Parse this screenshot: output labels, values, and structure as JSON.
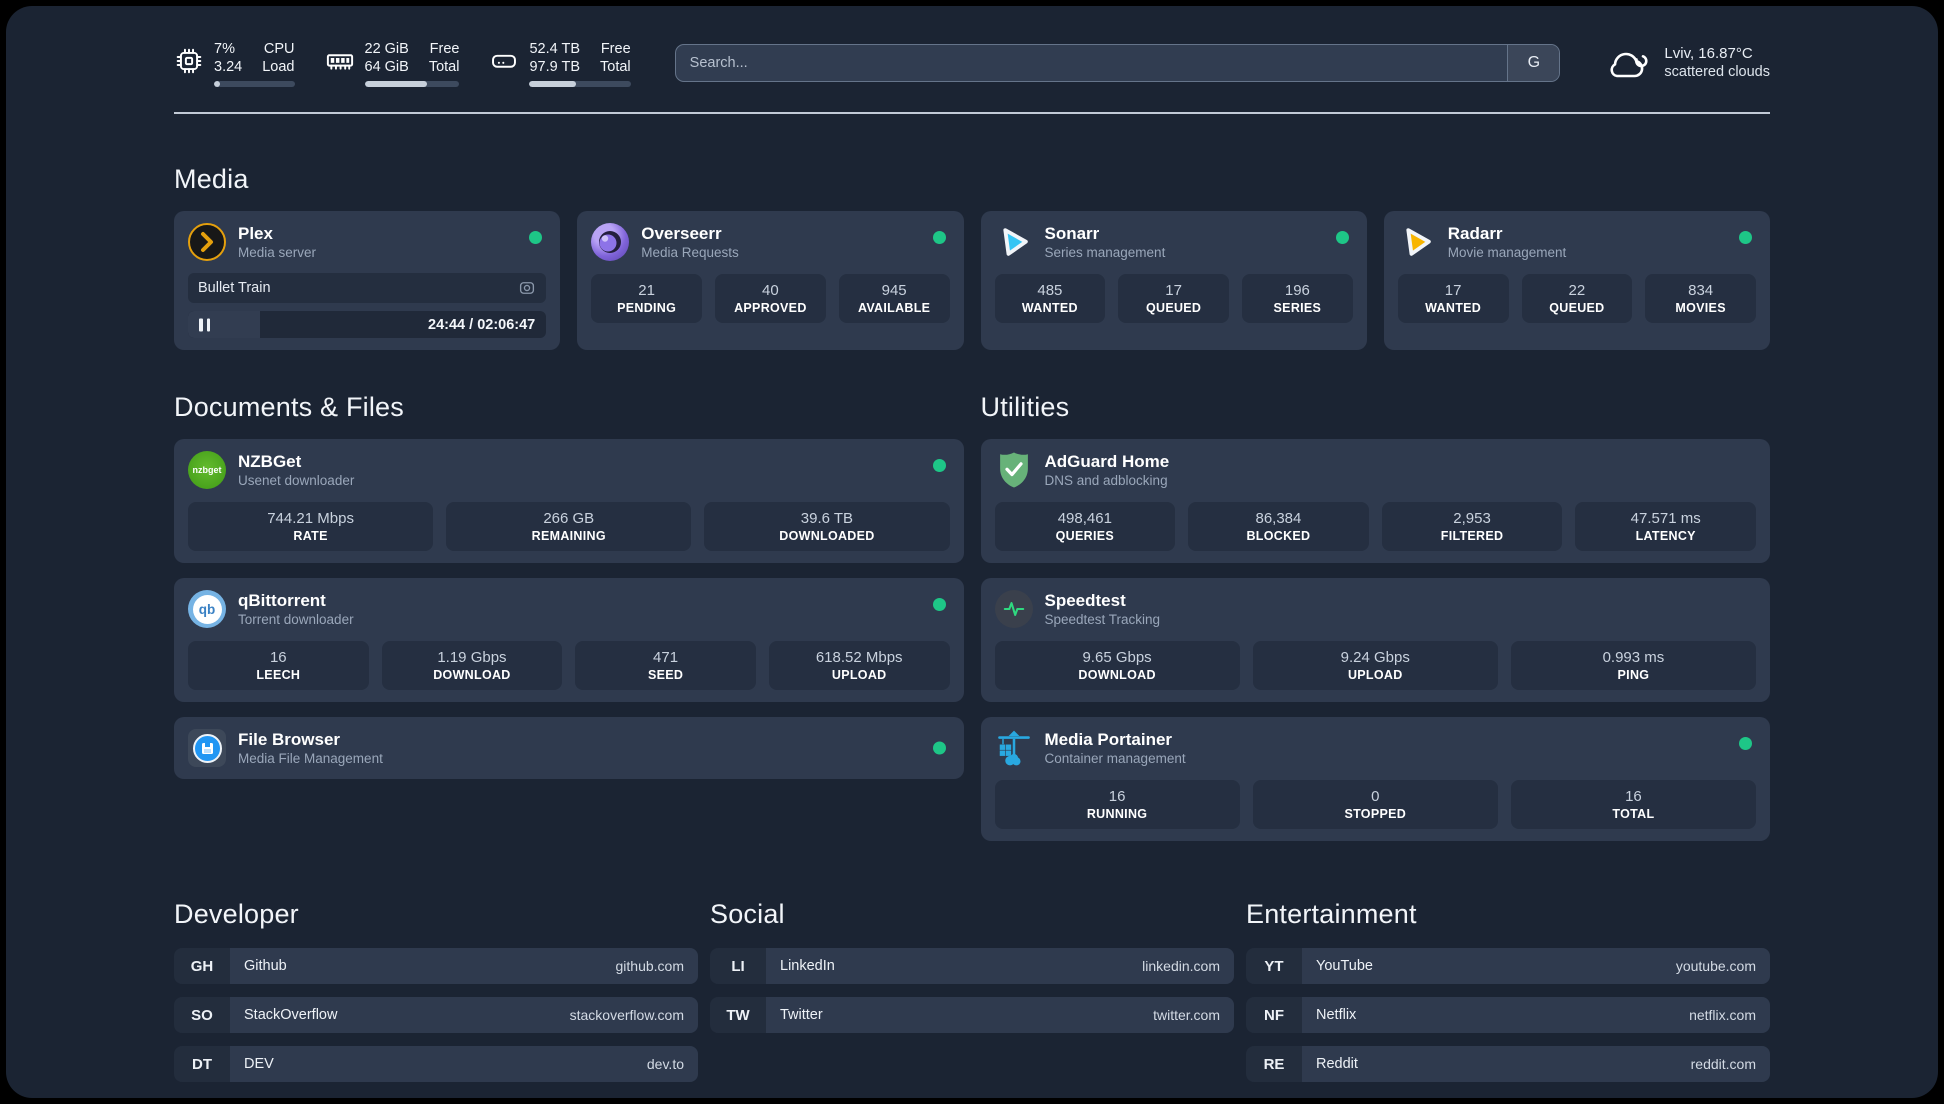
{
  "colors": {
    "accent_green": "#1ec687",
    "plex_amber": "#e5a00d",
    "sonarr_blue": "#35c5f4",
    "radarr_yellow": "#f8b500",
    "nzbget_green": "#4caf2f",
    "qbittorrent_blue": "#76b3e4",
    "adguard_green": "#67b279",
    "portainer_blue": "#29a8e0",
    "card_bg": "#2f3a4e",
    "page_bg": "#1b2433"
  },
  "header": {
    "stats": [
      {
        "icon": "cpu-icon",
        "value_top": "7%",
        "value_bottom": "3.24",
        "label_top": "CPU",
        "label_bottom": "Load",
        "progress_pct": 7
      },
      {
        "icon": "ram-icon",
        "value_top": "22 GiB",
        "value_bottom": "64 GiB",
        "label_top": "Free",
        "label_bottom": "Total",
        "progress_pct": 66
      },
      {
        "icon": "disk-icon",
        "value_top": "52.4 TB",
        "value_bottom": "97.9 TB",
        "label_top": "Free",
        "label_bottom": "Total",
        "progress_pct": 46
      }
    ],
    "search": {
      "placeholder": "Search...",
      "engine_label": "G"
    },
    "weather": {
      "location": "Lviv, 16.87°C",
      "condition": "scattered clouds"
    }
  },
  "sections": {
    "media": {
      "title": "Media",
      "plex": {
        "title": "Plex",
        "subtitle": "Media server",
        "online": true,
        "now_playing": "Bullet Train",
        "time": "24:44 / 02:06:47",
        "progress_pct": 20
      },
      "overseerr": {
        "title": "Overseerr",
        "subtitle": "Media Requests",
        "online": true,
        "stats": [
          {
            "value": "21",
            "label": "PENDING"
          },
          {
            "value": "40",
            "label": "APPROVED"
          },
          {
            "value": "945",
            "label": "AVAILABLE"
          }
        ]
      },
      "sonarr": {
        "title": "Sonarr",
        "subtitle": "Series management",
        "online": true,
        "stats": [
          {
            "value": "485",
            "label": "WANTED"
          },
          {
            "value": "17",
            "label": "QUEUED"
          },
          {
            "value": "196",
            "label": "SERIES"
          }
        ]
      },
      "radarr": {
        "title": "Radarr",
        "subtitle": "Movie management",
        "online": true,
        "stats": [
          {
            "value": "17",
            "label": "WANTED"
          },
          {
            "value": "22",
            "label": "QUEUED"
          },
          {
            "value": "834",
            "label": "MOVIES"
          }
        ]
      }
    },
    "documents": {
      "title": "Documents & Files",
      "nzbget": {
        "title": "NZBGet",
        "subtitle": "Usenet downloader",
        "online": true,
        "icon_text": "nzbget",
        "stats": [
          {
            "value": "744.21 Mbps",
            "label": "RATE"
          },
          {
            "value": "266 GB",
            "label": "REMAINING"
          },
          {
            "value": "39.6 TB",
            "label": "DOWNLOADED"
          }
        ]
      },
      "qbittorrent": {
        "title": "qBittorrent",
        "subtitle": "Torrent downloader",
        "online": true,
        "icon_text": "qb",
        "stats": [
          {
            "value": "16",
            "label": "LEECH"
          },
          {
            "value": "1.19 Gbps",
            "label": "DOWNLOAD"
          },
          {
            "value": "471",
            "label": "SEED"
          },
          {
            "value": "618.52 Mbps",
            "label": "UPLOAD"
          }
        ]
      },
      "filebrowser": {
        "title": "File Browser",
        "subtitle": "Media File Management",
        "online": true
      }
    },
    "utilities": {
      "title": "Utilities",
      "adguard": {
        "title": "AdGuard Home",
        "subtitle": "DNS and adblocking",
        "stats": [
          {
            "value": "498,461",
            "label": "QUERIES"
          },
          {
            "value": "86,384",
            "label": "BLOCKED"
          },
          {
            "value": "2,953",
            "label": "FILTERED"
          },
          {
            "value": "47.571 ms",
            "label": "LATENCY"
          }
        ]
      },
      "speedtest": {
        "title": "Speedtest",
        "subtitle": "Speedtest Tracking",
        "stats": [
          {
            "value": "9.65 Gbps",
            "label": "DOWNLOAD"
          },
          {
            "value": "9.24 Gbps",
            "label": "UPLOAD"
          },
          {
            "value": "0.993 ms",
            "label": "PING"
          }
        ]
      },
      "portainer": {
        "title": "Media Portainer",
        "subtitle": "Container management",
        "online": true,
        "stats": [
          {
            "value": "16",
            "label": "RUNNING"
          },
          {
            "value": "0",
            "label": "STOPPED"
          },
          {
            "value": "16",
            "label": "TOTAL"
          }
        ]
      }
    },
    "links": {
      "developer": {
        "title": "Developer",
        "items": [
          {
            "tag": "GH",
            "name": "Github",
            "url": "github.com"
          },
          {
            "tag": "SO",
            "name": "StackOverflow",
            "url": "stackoverflow.com"
          },
          {
            "tag": "DT",
            "name": "DEV",
            "url": "dev.to"
          }
        ]
      },
      "social": {
        "title": "Social",
        "items": [
          {
            "tag": "LI",
            "name": "LinkedIn",
            "url": "linkedin.com"
          },
          {
            "tag": "TW",
            "name": "Twitter",
            "url": "twitter.com"
          }
        ]
      },
      "entertainment": {
        "title": "Entertainment",
        "items": [
          {
            "tag": "YT",
            "name": "YouTube",
            "url": "youtube.com"
          },
          {
            "tag": "NF",
            "name": "Netflix",
            "url": "netflix.com"
          },
          {
            "tag": "RE",
            "name": "Reddit",
            "url": "reddit.com"
          }
        ]
      }
    }
  }
}
